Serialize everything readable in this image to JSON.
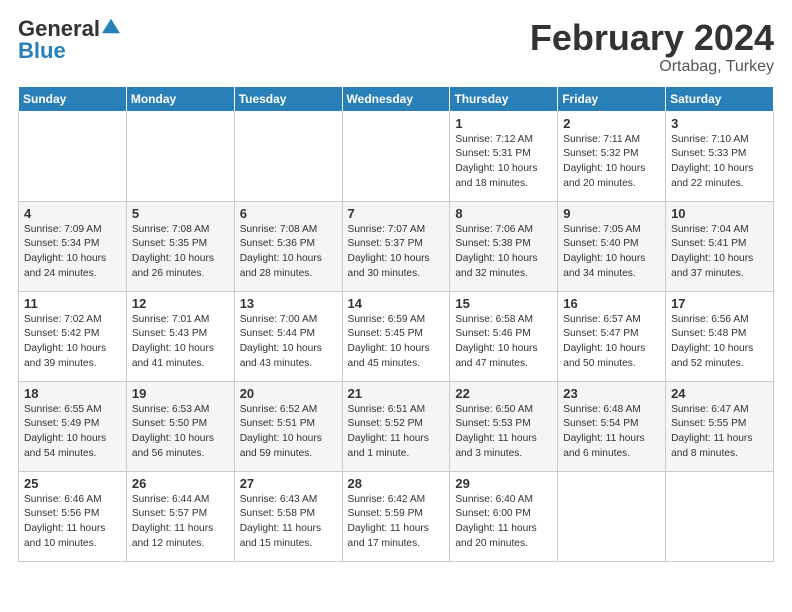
{
  "header": {
    "logo_general": "General",
    "logo_blue": "Blue",
    "title": "February 2024",
    "subtitle": "Ortabag, Turkey"
  },
  "weekdays": [
    "Sunday",
    "Monday",
    "Tuesday",
    "Wednesday",
    "Thursday",
    "Friday",
    "Saturday"
  ],
  "weeks": [
    [
      {
        "day": "",
        "info": ""
      },
      {
        "day": "",
        "info": ""
      },
      {
        "day": "",
        "info": ""
      },
      {
        "day": "",
        "info": ""
      },
      {
        "day": "1",
        "info": "Sunrise: 7:12 AM\nSunset: 5:31 PM\nDaylight: 10 hours\nand 18 minutes."
      },
      {
        "day": "2",
        "info": "Sunrise: 7:11 AM\nSunset: 5:32 PM\nDaylight: 10 hours\nand 20 minutes."
      },
      {
        "day": "3",
        "info": "Sunrise: 7:10 AM\nSunset: 5:33 PM\nDaylight: 10 hours\nand 22 minutes."
      }
    ],
    [
      {
        "day": "4",
        "info": "Sunrise: 7:09 AM\nSunset: 5:34 PM\nDaylight: 10 hours\nand 24 minutes."
      },
      {
        "day": "5",
        "info": "Sunrise: 7:08 AM\nSunset: 5:35 PM\nDaylight: 10 hours\nand 26 minutes."
      },
      {
        "day": "6",
        "info": "Sunrise: 7:08 AM\nSunset: 5:36 PM\nDaylight: 10 hours\nand 28 minutes."
      },
      {
        "day": "7",
        "info": "Sunrise: 7:07 AM\nSunset: 5:37 PM\nDaylight: 10 hours\nand 30 minutes."
      },
      {
        "day": "8",
        "info": "Sunrise: 7:06 AM\nSunset: 5:38 PM\nDaylight: 10 hours\nand 32 minutes."
      },
      {
        "day": "9",
        "info": "Sunrise: 7:05 AM\nSunset: 5:40 PM\nDaylight: 10 hours\nand 34 minutes."
      },
      {
        "day": "10",
        "info": "Sunrise: 7:04 AM\nSunset: 5:41 PM\nDaylight: 10 hours\nand 37 minutes."
      }
    ],
    [
      {
        "day": "11",
        "info": "Sunrise: 7:02 AM\nSunset: 5:42 PM\nDaylight: 10 hours\nand 39 minutes."
      },
      {
        "day": "12",
        "info": "Sunrise: 7:01 AM\nSunset: 5:43 PM\nDaylight: 10 hours\nand 41 minutes."
      },
      {
        "day": "13",
        "info": "Sunrise: 7:00 AM\nSunset: 5:44 PM\nDaylight: 10 hours\nand 43 minutes."
      },
      {
        "day": "14",
        "info": "Sunrise: 6:59 AM\nSunset: 5:45 PM\nDaylight: 10 hours\nand 45 minutes."
      },
      {
        "day": "15",
        "info": "Sunrise: 6:58 AM\nSunset: 5:46 PM\nDaylight: 10 hours\nand 47 minutes."
      },
      {
        "day": "16",
        "info": "Sunrise: 6:57 AM\nSunset: 5:47 PM\nDaylight: 10 hours\nand 50 minutes."
      },
      {
        "day": "17",
        "info": "Sunrise: 6:56 AM\nSunset: 5:48 PM\nDaylight: 10 hours\nand 52 minutes."
      }
    ],
    [
      {
        "day": "18",
        "info": "Sunrise: 6:55 AM\nSunset: 5:49 PM\nDaylight: 10 hours\nand 54 minutes."
      },
      {
        "day": "19",
        "info": "Sunrise: 6:53 AM\nSunset: 5:50 PM\nDaylight: 10 hours\nand 56 minutes."
      },
      {
        "day": "20",
        "info": "Sunrise: 6:52 AM\nSunset: 5:51 PM\nDaylight: 10 hours\nand 59 minutes."
      },
      {
        "day": "21",
        "info": "Sunrise: 6:51 AM\nSunset: 5:52 PM\nDaylight: 11 hours\nand 1 minute."
      },
      {
        "day": "22",
        "info": "Sunrise: 6:50 AM\nSunset: 5:53 PM\nDaylight: 11 hours\nand 3 minutes."
      },
      {
        "day": "23",
        "info": "Sunrise: 6:48 AM\nSunset: 5:54 PM\nDaylight: 11 hours\nand 6 minutes."
      },
      {
        "day": "24",
        "info": "Sunrise: 6:47 AM\nSunset: 5:55 PM\nDaylight: 11 hours\nand 8 minutes."
      }
    ],
    [
      {
        "day": "25",
        "info": "Sunrise: 6:46 AM\nSunset: 5:56 PM\nDaylight: 11 hours\nand 10 minutes."
      },
      {
        "day": "26",
        "info": "Sunrise: 6:44 AM\nSunset: 5:57 PM\nDaylight: 11 hours\nand 12 minutes."
      },
      {
        "day": "27",
        "info": "Sunrise: 6:43 AM\nSunset: 5:58 PM\nDaylight: 11 hours\nand 15 minutes."
      },
      {
        "day": "28",
        "info": "Sunrise: 6:42 AM\nSunset: 5:59 PM\nDaylight: 11 hours\nand 17 minutes."
      },
      {
        "day": "29",
        "info": "Sunrise: 6:40 AM\nSunset: 6:00 PM\nDaylight: 11 hours\nand 20 minutes."
      },
      {
        "day": "",
        "info": ""
      },
      {
        "day": "",
        "info": ""
      }
    ]
  ]
}
